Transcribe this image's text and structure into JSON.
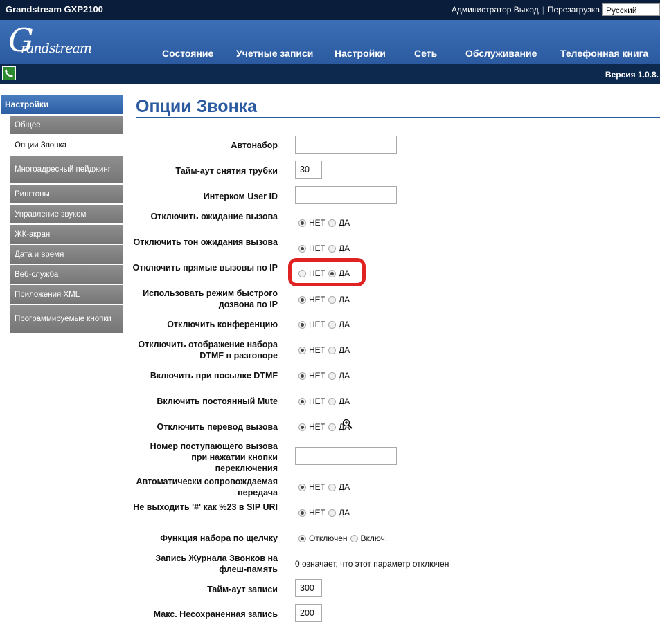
{
  "topbar": {
    "model": "Grandstream GXP2100",
    "admin_logout": "Администратор Выход",
    "reboot": "Перезагрузка",
    "language": "Русский"
  },
  "logo": {
    "initial": "G",
    "wordmark": "randstream"
  },
  "nav": [
    "Состояние",
    "Учетные записи",
    "Настройки",
    "Сеть",
    "Обслуживание",
    "Телефонная книга"
  ],
  "version": "Версия 1.0.8.",
  "sidebar": {
    "header": "Настройки",
    "items": [
      {
        "label": "Общее"
      },
      {
        "label": "Опции Звонка",
        "active": true
      },
      {
        "label": "Многоадресный пейджинг"
      },
      {
        "label": "Рингтоны"
      },
      {
        "label": "Управление звуком"
      },
      {
        "label": "ЖК-экран"
      },
      {
        "label": "Дата и время"
      },
      {
        "label": "Веб-служба"
      },
      {
        "label": "Приложения XML"
      },
      {
        "label": "Программируемые кнопки"
      }
    ]
  },
  "page_title": "Опции Звонка",
  "radio_labels": {
    "no": "НЕТ",
    "yes": "ДА",
    "off": "Отключен",
    "on": "Включ."
  },
  "fields": {
    "autodial": {
      "label": "Автонабор",
      "value": ""
    },
    "offhook_timeout": {
      "label": "Тайм-аут снятия трубки",
      "value": "30"
    },
    "intercom_user_id": {
      "label": "Интерком User ID",
      "value": ""
    },
    "disable_call_waiting": {
      "label": "Отключить ожидание вызова",
      "selected": "НЕТ"
    },
    "disable_call_waiting_tone": {
      "label": "Отключить тон ожидания вызова",
      "selected": "НЕТ"
    },
    "disable_direct_ip_call": {
      "label": "Отключить прямые вызовы по IP",
      "selected": "ДА"
    },
    "use_quick_ip_call": {
      "label": "Использовать режим быстрого дозвона по IP",
      "selected": "НЕТ"
    },
    "disable_conference": {
      "label": "Отключить конференцию",
      "selected": "НЕТ"
    },
    "hide_dtmf_display": {
      "label": "Отключить отображение набора DTMF в разговоре",
      "selected": "НЕТ"
    },
    "enable_send_dtmf": {
      "label": "Включить при посылке DTMF",
      "selected": "НЕТ"
    },
    "enable_constant_mute": {
      "label": "Включить постоянный Mute",
      "selected": "НЕТ"
    },
    "disable_call_transfer": {
      "label": "Отключить перевод вызова",
      "selected": "НЕТ"
    },
    "incoming_call_switch_number": {
      "label": "Номер поступающего вызова при нажатии кнопки переключения",
      "value": ""
    },
    "auto_attended_transfer": {
      "label": "Автоматически сопровождаемая передача",
      "selected": "НЕТ"
    },
    "no_escape_hash": {
      "label": "Не выходить '#' как %23 в SIP URI",
      "selected": "НЕТ"
    },
    "click_to_dial": {
      "label": "Функция набора по щелчку",
      "selected": "Отключен"
    },
    "call_log_flash": {
      "label": "Запись Журнала Звонков на флеш-память",
      "note": "0 означает, что этот параметр отключен"
    },
    "record_timeout": {
      "label": "Тайм-аут записи",
      "value": "300"
    },
    "max_unsaved_record": {
      "label": "Макс. Несохраненная запись",
      "value": "200"
    }
  },
  "colors": {
    "highlight": "#e02222",
    "accent": "#2b5aa0",
    "topbar": "#0a1e3c"
  }
}
